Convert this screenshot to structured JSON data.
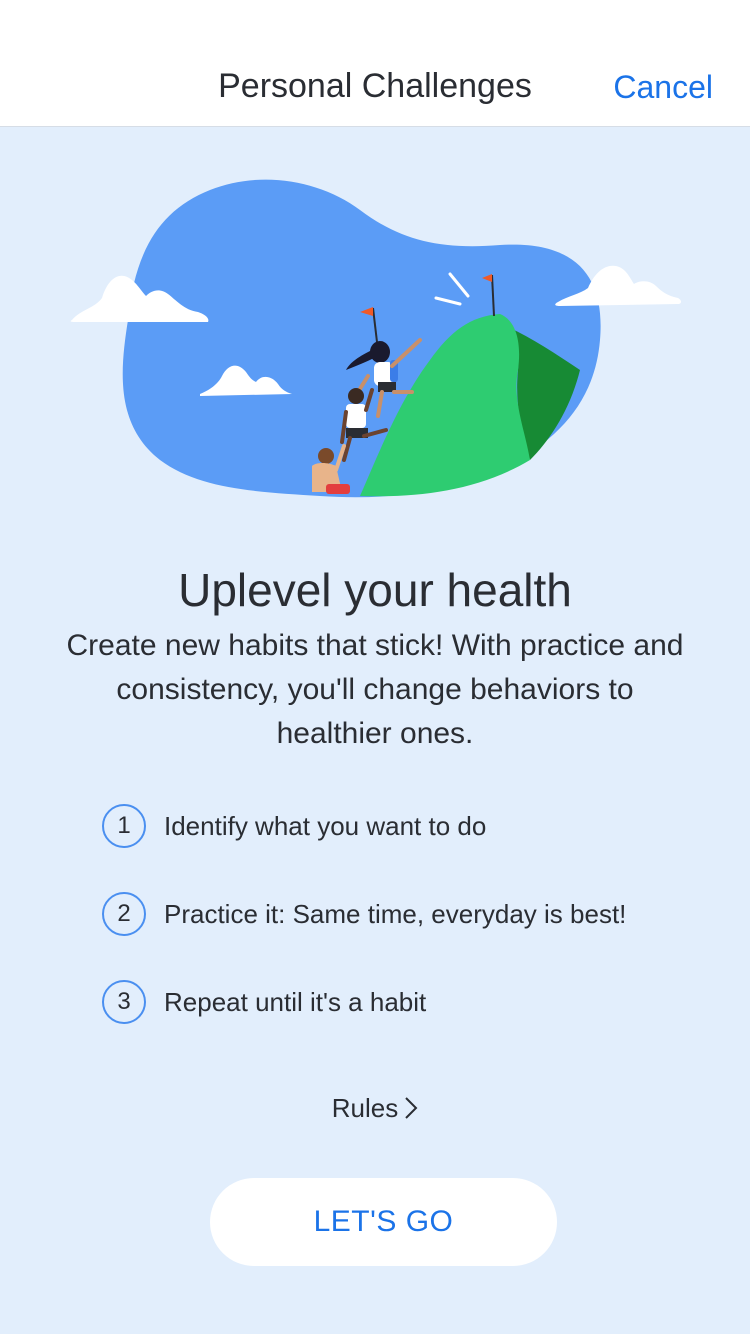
{
  "navbar": {
    "title": "Personal Challenges",
    "cancel_label": "Cancel"
  },
  "main": {
    "headline": "Uplevel your health",
    "subtitle": "Create new habits that stick! With practice and consistency, you'll change behaviors to healthier ones.",
    "steps": [
      {
        "number": "1",
        "text": "Identify what you want to do"
      },
      {
        "number": "2",
        "text": "Practice it: Same time, everyday is best!"
      },
      {
        "number": "3",
        "text": "Repeat until it's a habit"
      }
    ],
    "rules_label": "Rules",
    "cta_label": "LET'S GO"
  },
  "colors": {
    "background": "#e2eefc",
    "accent": "#1b73e8",
    "step_ring": "#4a8ff0",
    "sky": "#5b9cf6",
    "mountain": "#2ecc71",
    "mountain_shadow": "#178a34",
    "flag": "#f05a28"
  },
  "icons": {
    "rules_chevron": "chevron-right-icon"
  }
}
